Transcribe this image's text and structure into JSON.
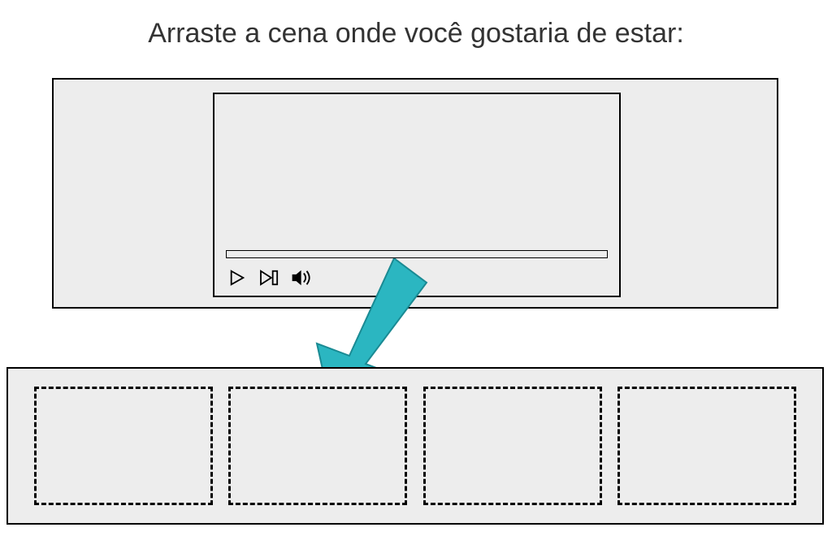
{
  "title": "Arraste a cena onde você gostaria de estar:",
  "controls": {
    "play_label": "play",
    "play_step_label": "play-step",
    "volume_label": "volume"
  },
  "arrow": {
    "color": "#2bb6c1",
    "stroke": "#1e9aa3"
  },
  "dropzones": {
    "count": 4
  }
}
